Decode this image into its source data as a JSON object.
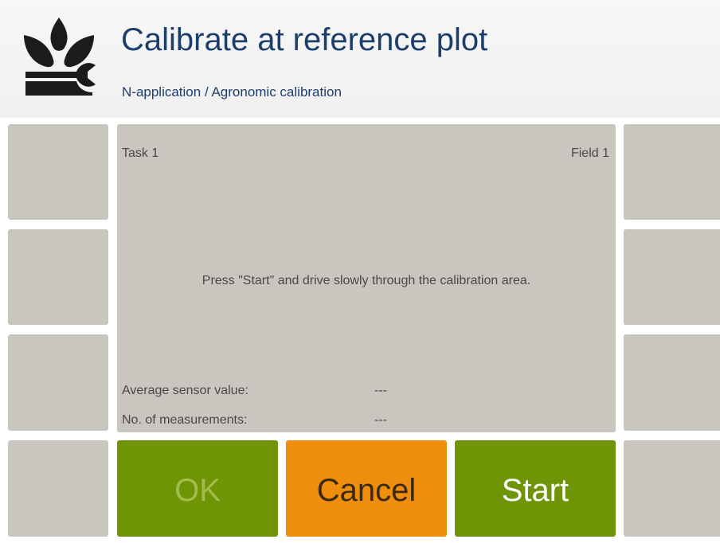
{
  "header": {
    "title": "Calibrate at reference plot",
    "subtitle": "N-application / Agronomic calibration",
    "icon": "plant-wrench-icon",
    "title_color": "#1c3e6b"
  },
  "panel": {
    "task": "Task 1",
    "field": "Field 1",
    "instruction": "Press \"Start\" and drive slowly through the calibration area.",
    "average_sensor_label": "Average sensor value:",
    "average_sensor_value": "---",
    "measurements_label": "No. of measurements:",
    "measurements_value": "---",
    "background": "#c9c6c0"
  },
  "buttons": {
    "ok": "OK",
    "cancel": "Cancel",
    "start": "Start",
    "ok_disabled": true,
    "green": "#6f9506",
    "orange": "#ee8e0c"
  }
}
